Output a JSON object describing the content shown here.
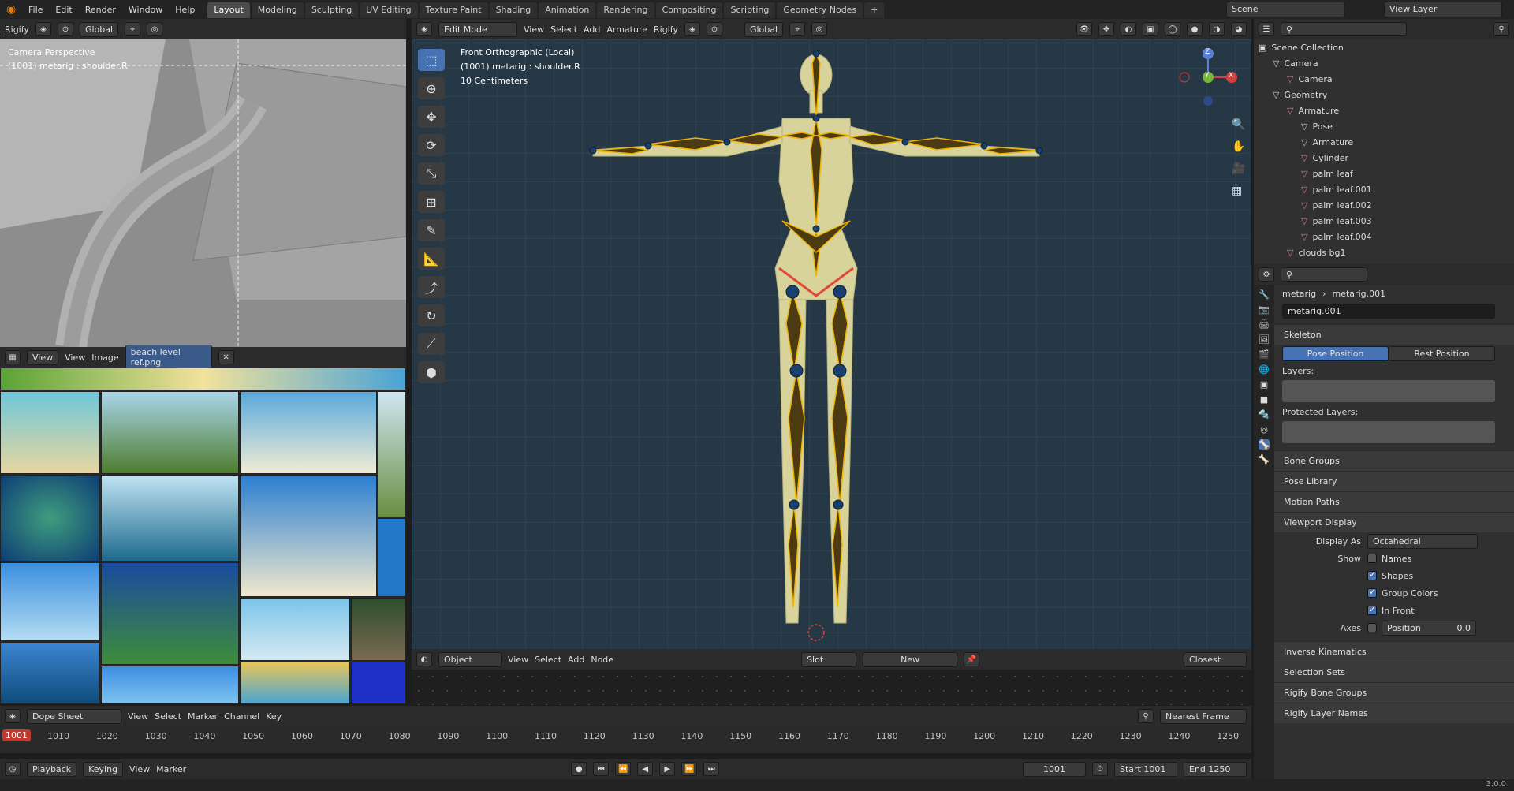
{
  "topbar": {
    "menus": [
      "File",
      "Edit",
      "Render",
      "Window",
      "Help"
    ],
    "workspaces": [
      "Layout",
      "Modeling",
      "Sculpting",
      "UV Editing",
      "Texture Paint",
      "Shading",
      "Animation",
      "Rendering",
      "Compositing",
      "Scripting",
      "Geometry Nodes"
    ],
    "active_workspace": "Layout",
    "scene": "Scene",
    "view_layer": "View Layer"
  },
  "left_view": {
    "header_label": "Rigify",
    "orient": "Global",
    "title1": "Camera Perspective",
    "title2": "(1001) metarig : shoulder.R"
  },
  "image_editor": {
    "menus": [
      "View",
      "View",
      "Image"
    ],
    "image_name": "beach level ref.png"
  },
  "main_view": {
    "mode": "Edit Mode",
    "menus": [
      "View",
      "Select",
      "Armature",
      "Rigify"
    ],
    "add": "Add",
    "orient": "Global",
    "info1": "Front Orthographic (Local)",
    "info2": "(1001) metarig : shoulder.R",
    "info3": "10 Centimeters",
    "gizmo": {
      "x": "X",
      "y": "Y",
      "z": "Z"
    }
  },
  "node_header": {
    "object": "Object",
    "menus": [
      "View",
      "Select",
      "Add",
      "Node"
    ],
    "slot": "Slot",
    "new": "New",
    "snap": "Closest"
  },
  "dopesheet": {
    "mode": "Dope Sheet",
    "menus": [
      "View",
      "Select",
      "Marker",
      "Channel",
      "Key"
    ],
    "snap": "Nearest Frame",
    "current": "1001",
    "ticks": [
      "1010",
      "1020",
      "1030",
      "1040",
      "1050",
      "1060",
      "1070",
      "1080",
      "1090",
      "1100",
      "1110",
      "1120",
      "1130",
      "1140",
      "1150",
      "1160",
      "1170",
      "1180",
      "1190",
      "1200",
      "1210",
      "1220",
      "1230",
      "1240",
      "1250"
    ]
  },
  "timeline": {
    "menus": [
      "Playback",
      "Keying",
      "View",
      "Marker"
    ],
    "frame": "1001",
    "start_label": "Start",
    "start": "1001",
    "end_label": "End",
    "end": "1250"
  },
  "outliner": {
    "root": "Scene Collection",
    "rows": [
      {
        "label": "Camera",
        "indent": 1,
        "color": "#c8c8c8"
      },
      {
        "label": "Camera",
        "indent": 2,
        "color": "#d9738d"
      },
      {
        "label": "Geometry",
        "indent": 1,
        "color": "#c8c8c8"
      },
      {
        "label": "Armature",
        "indent": 2,
        "color": "#d9738d"
      },
      {
        "label": "Pose",
        "indent": 3,
        "color": "#c8c8c8"
      },
      {
        "label": "Armature",
        "indent": 3,
        "color": "#c8c8c8"
      },
      {
        "label": "Cylinder",
        "indent": 3,
        "color": "#d9738d"
      },
      {
        "label": "palm leaf",
        "indent": 3,
        "color": "#d9738d"
      },
      {
        "label": "palm leaf.001",
        "indent": 3,
        "color": "#d9738d"
      },
      {
        "label": "palm leaf.002",
        "indent": 3,
        "color": "#d9738d"
      },
      {
        "label": "palm leaf.003",
        "indent": 3,
        "color": "#d9738d"
      },
      {
        "label": "palm leaf.004",
        "indent": 3,
        "color": "#d9738d"
      },
      {
        "label": "clouds bg1",
        "indent": 2,
        "color": "#d9738d"
      }
    ]
  },
  "properties": {
    "breadcrumb1": "metarig",
    "breadcrumb2": "metarig.001",
    "name": "metarig.001",
    "skeleton": "Skeleton",
    "pose_position": "Pose Position",
    "rest_position": "Rest Position",
    "layers": "Layers:",
    "protected_layers": "Protected Layers:",
    "bone_groups": "Bone Groups",
    "pose_library": "Pose Library",
    "motion_paths": "Motion Paths",
    "viewport_display": "Viewport Display",
    "display_as_label": "Display As",
    "display_as": "Octahedral",
    "show_label": "Show",
    "names": "Names",
    "shapes": "Shapes",
    "group_colors": "Group Colors",
    "in_front": "In Front",
    "axes_label": "Axes",
    "position_label": "Position",
    "position_value": "0.0",
    "inverse_kinematics": "Inverse Kinematics",
    "selection_sets": "Selection Sets",
    "rigify_bone_groups": "Rigify Bone Groups",
    "rigify_layer_names": "Rigify Layer Names"
  },
  "status": {
    "version": "3.0.0"
  }
}
